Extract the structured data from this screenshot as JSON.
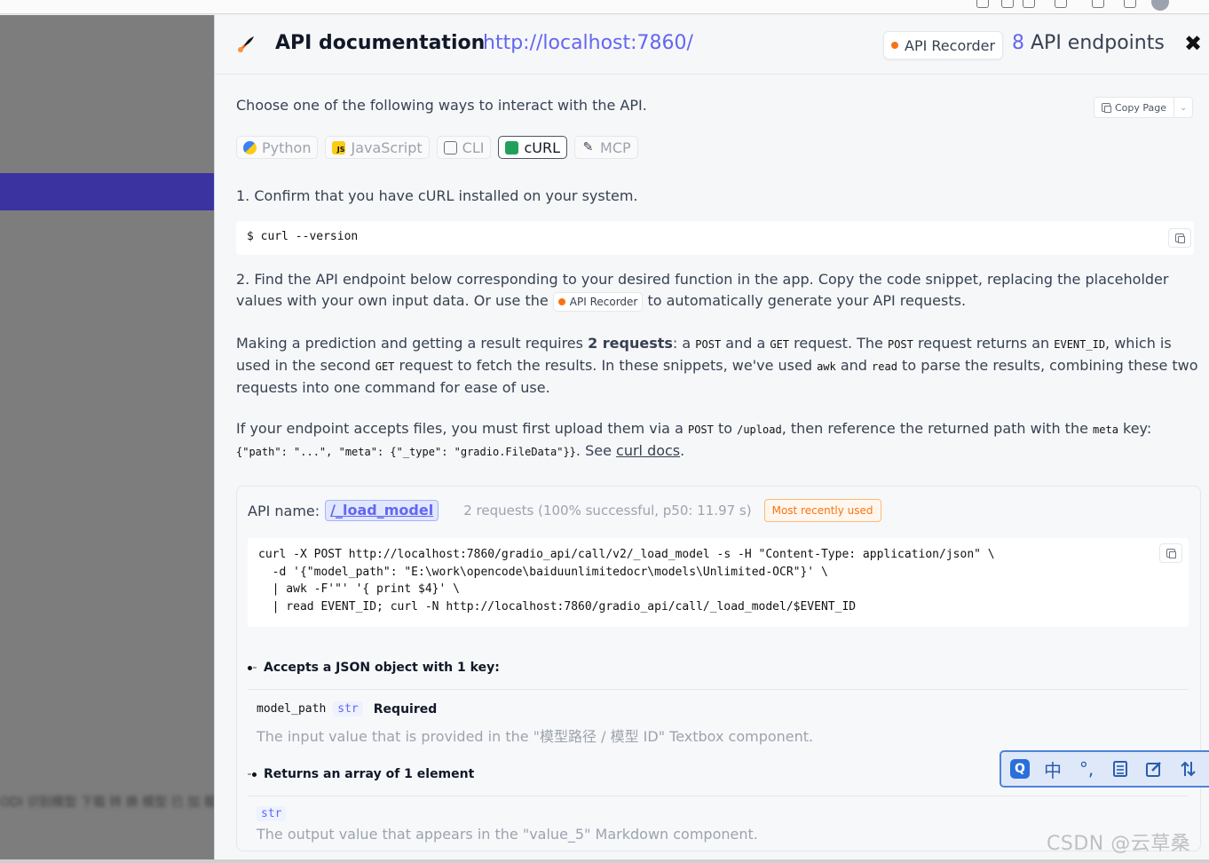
{
  "colors": {
    "accent": "#6366f1",
    "recorder_dot": "#f97316",
    "backdrop": "#7d7d7d",
    "backdrop_bar": "#3b33a0"
  },
  "backdrop": {
    "blur_text": "ODI 识别模型 下载 转 换 模型 已 加 载"
  },
  "header": {
    "title": "API documentation",
    "url": "http://localhost:7860/",
    "recorder_label": "API Recorder",
    "endpoint_count": "8",
    "endpoint_label": "API endpoints",
    "close_icon": "close-icon"
  },
  "intro": "Choose one of the following ways to interact with the API.",
  "copy_page": {
    "label": "Copy Page",
    "arrow": "⌄"
  },
  "tabs": [
    {
      "label": "Python",
      "icon": "python-icon",
      "active": false
    },
    {
      "label": "JavaScript",
      "icon": "javascript-icon",
      "active": false
    },
    {
      "label": "CLI",
      "icon": "cli-icon",
      "active": false
    },
    {
      "label": "cURL",
      "icon": "curl-icon",
      "active": true
    },
    {
      "label": "MCP",
      "icon": "mcp-icon",
      "active": false
    }
  ],
  "step1": "1. Confirm that you have cURL installed on your system.",
  "version_cmd": "$ curl --version",
  "step2": {
    "text_a": "2. Find the API endpoint below corresponding to your desired function in the app. Copy the code snippet, replacing the placeholder values with your own input data. Or use the ",
    "recorder_label": "API Recorder",
    "text_b": " to automatically generate your API requests."
  },
  "para3": {
    "a": "Making a prediction and getting a result requires ",
    "bold": "2 requests",
    "b": ": a ",
    "post1": "POST",
    "c": " and a ",
    "get1": "GET",
    "d": " request. The ",
    "post2": "POST",
    "e": " request returns an ",
    "event_id": "EVENT_ID",
    "f": ", which is used in the second ",
    "get2": "GET",
    "g": " request to fetch the results. In these snippets, we've used ",
    "awk": "awk",
    "h": " and ",
    "read": "read",
    "i": " to parse the results, combining these two requests into one command for ease of use."
  },
  "para4": {
    "a": "If your endpoint accepts files, you must first upload them via a ",
    "post": "POST",
    "b": " to ",
    "upload": "/upload",
    "c": ", then reference the returned path with the ",
    "meta": "meta",
    "d": " key:",
    "json": "{\"path\": \"...\", \"meta\": {\"_type\": \"gradio.FileData\"}}",
    "e": ". See ",
    "link": "curl docs",
    "f": "."
  },
  "endpoint": {
    "name_label": "API name:",
    "name": "/_load_model",
    "stats": "2 requests (100% successful, p50: 11.97 s)",
    "badge": "Most recently used",
    "code": [
      "curl -X POST http://localhost:7860/gradio_api/call/v2/_load_model -s -H \"Content-Type: application/json\" \\",
      "  -d '{\"model_path\": \"E:\\work\\opencode\\baiduunlimitedocr\\models\\Unlimited-OCR\"}' \\",
      "  | awk -F'\"' '{ print $4}' \\",
      "  | read EVENT_ID; curl -N http://localhost:7860/gradio_api/call/_load_model/$EVENT_ID"
    ],
    "accepts_label": "Accepts a JSON object with 1 key:",
    "param_name": "model_path",
    "param_type": "str",
    "param_req": "Required",
    "param_desc": "The input value that is provided in the \"模型路径 / 模型 ID\" Textbox component.",
    "returns_label": "Returns an array of 1 element",
    "return_type": "str",
    "return_desc": "The output value that appears in the \"value_5\" Markdown component."
  },
  "ime": {
    "q": "Q",
    "zh": "中",
    "punct": "°,",
    "icons": [
      "ime-search-icon",
      "ime-chinese-icon",
      "ime-punct-icon",
      "ime-keyboard-icon",
      "ime-edit-icon",
      "ime-tools-icon"
    ]
  },
  "watermark": "CSDN @云草桑"
}
